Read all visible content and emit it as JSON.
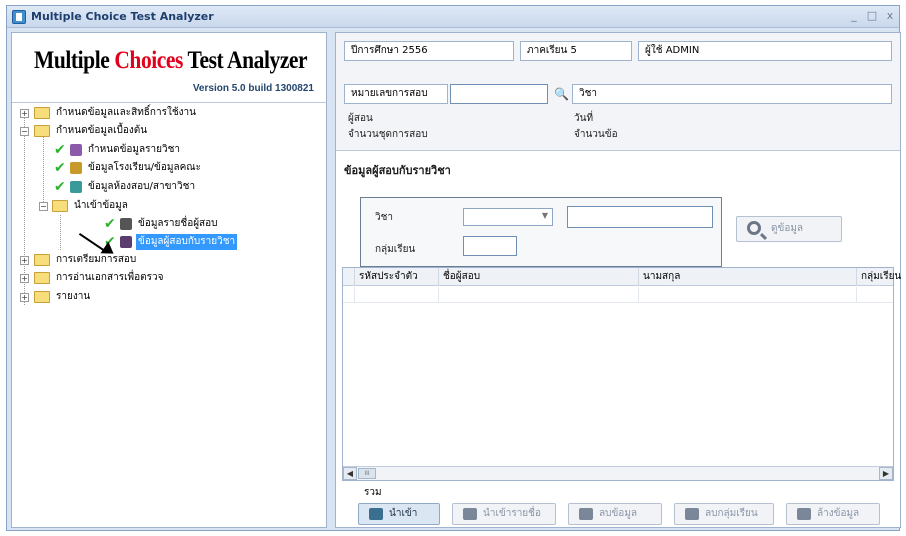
{
  "window": {
    "title": "Multiple Choice Test Analyzer",
    "minimize": "_",
    "maximize": "□",
    "close": "x"
  },
  "logo": {
    "part1": "Multiple ",
    "part2": "Choices",
    "part3": " Test Analyzer",
    "version": "Version 5.0  build 1300821"
  },
  "tree": {
    "n1": "กำหนดข้อมูลและสิทธิ์การใช้งาน",
    "n2": "กำหนดข้อมูลเบื้องต้น",
    "n2a": "กำหนดข้อมูลรายวิชา",
    "n2b": "ข้อมูลโรงเรียน/ข้อมูลคณะ",
    "n2c": "ข้อมูลห้องสอบ/สาขาวิชา",
    "n2d": "นำเข้าข้อมูล",
    "n2d1": "ข้อมูลรายชื่อผู้สอบ",
    "n2d2": "ข้อมูลผู้สอบกับรายวิชา",
    "n3": "การเตรียมการสอบ",
    "n4": "การอ่านเอกสารเพื่อตรวจ",
    "n5": "รายงาน"
  },
  "info": {
    "year_label": "ปีการศึกษา  2556",
    "term_label": "ภาคเรียน  5",
    "user_label": "ผู้ใช้   ADMIN",
    "exam_no_label": "หมายเลขการสอบ",
    "exam_no_value": "",
    "subject_label": "วิชา",
    "teacher_label": "ผู้สอน",
    "set_count_label": "จำนวนชุดการสอบ",
    "date_label": "วันที่",
    "item_count_label": "จำนวนข้อ"
  },
  "section": {
    "title": "ข้อมูลผู้สอบกับรายวิชา"
  },
  "filter": {
    "subject_label": "วิชา",
    "group_label": "กลุ่มเรียน",
    "subject_value": "",
    "subject_text": "",
    "group_value": "",
    "view_button": "ดูข้อมูล"
  },
  "grid": {
    "columns": [
      "รหัสประจำตัว",
      "ชื่อผู้สอบ",
      "นามสกุล",
      "กลุ่มเรียน"
    ],
    "scroll_thumb": "III"
  },
  "footer": {
    "total_label": "รวม",
    "buttons": [
      "นำเข้า",
      "นำเข้ารายชื่อ",
      "ลบข้อมูล",
      "ลบกลุ่มเรียน",
      "ล้างข้อมูล"
    ]
  }
}
